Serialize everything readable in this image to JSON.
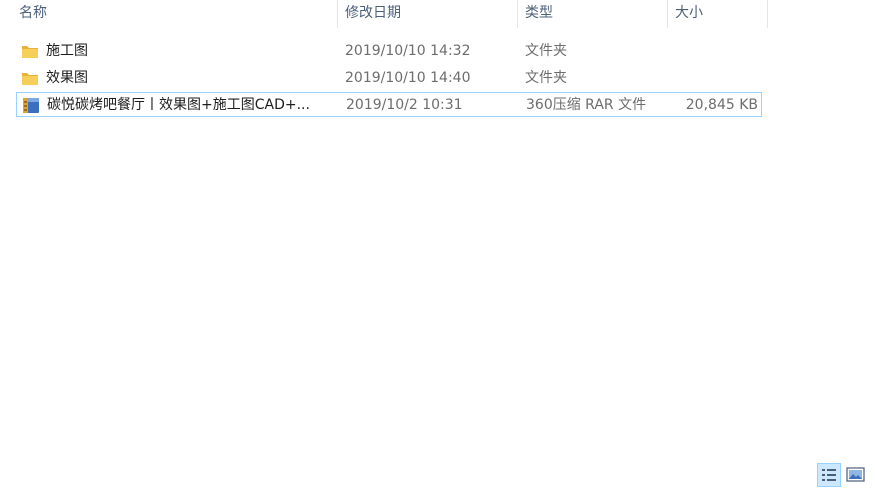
{
  "columns": {
    "name": "名称",
    "date": "修改日期",
    "type": "类型",
    "size": "大小"
  },
  "files": [
    {
      "icon": "folder-icon",
      "name": "施工图",
      "date": "2019/10/10 14:32",
      "type": "文件夹",
      "size": ""
    },
    {
      "icon": "folder-icon",
      "name": "效果图",
      "date": "2019/10/10 14:40",
      "type": "文件夹",
      "size": ""
    },
    {
      "icon": "rar-archive-icon",
      "name": "碳悦碳烤吧餐厅丨效果图+施工图CAD+...",
      "date": "2019/10/2 10:31",
      "type": "360压缩 RAR 文件",
      "size": "20,845 KB",
      "selected": true
    }
  ],
  "status_bar": {
    "details_view_icon": "details-view-icon",
    "tiles_view_icon": "large-icons-view-icon"
  },
  "colors": {
    "header_text": "#4c607a",
    "selection_border": "#99d1ff",
    "selection_fill": "#cce8ff",
    "folder_yellow": "#f6cf5b"
  }
}
